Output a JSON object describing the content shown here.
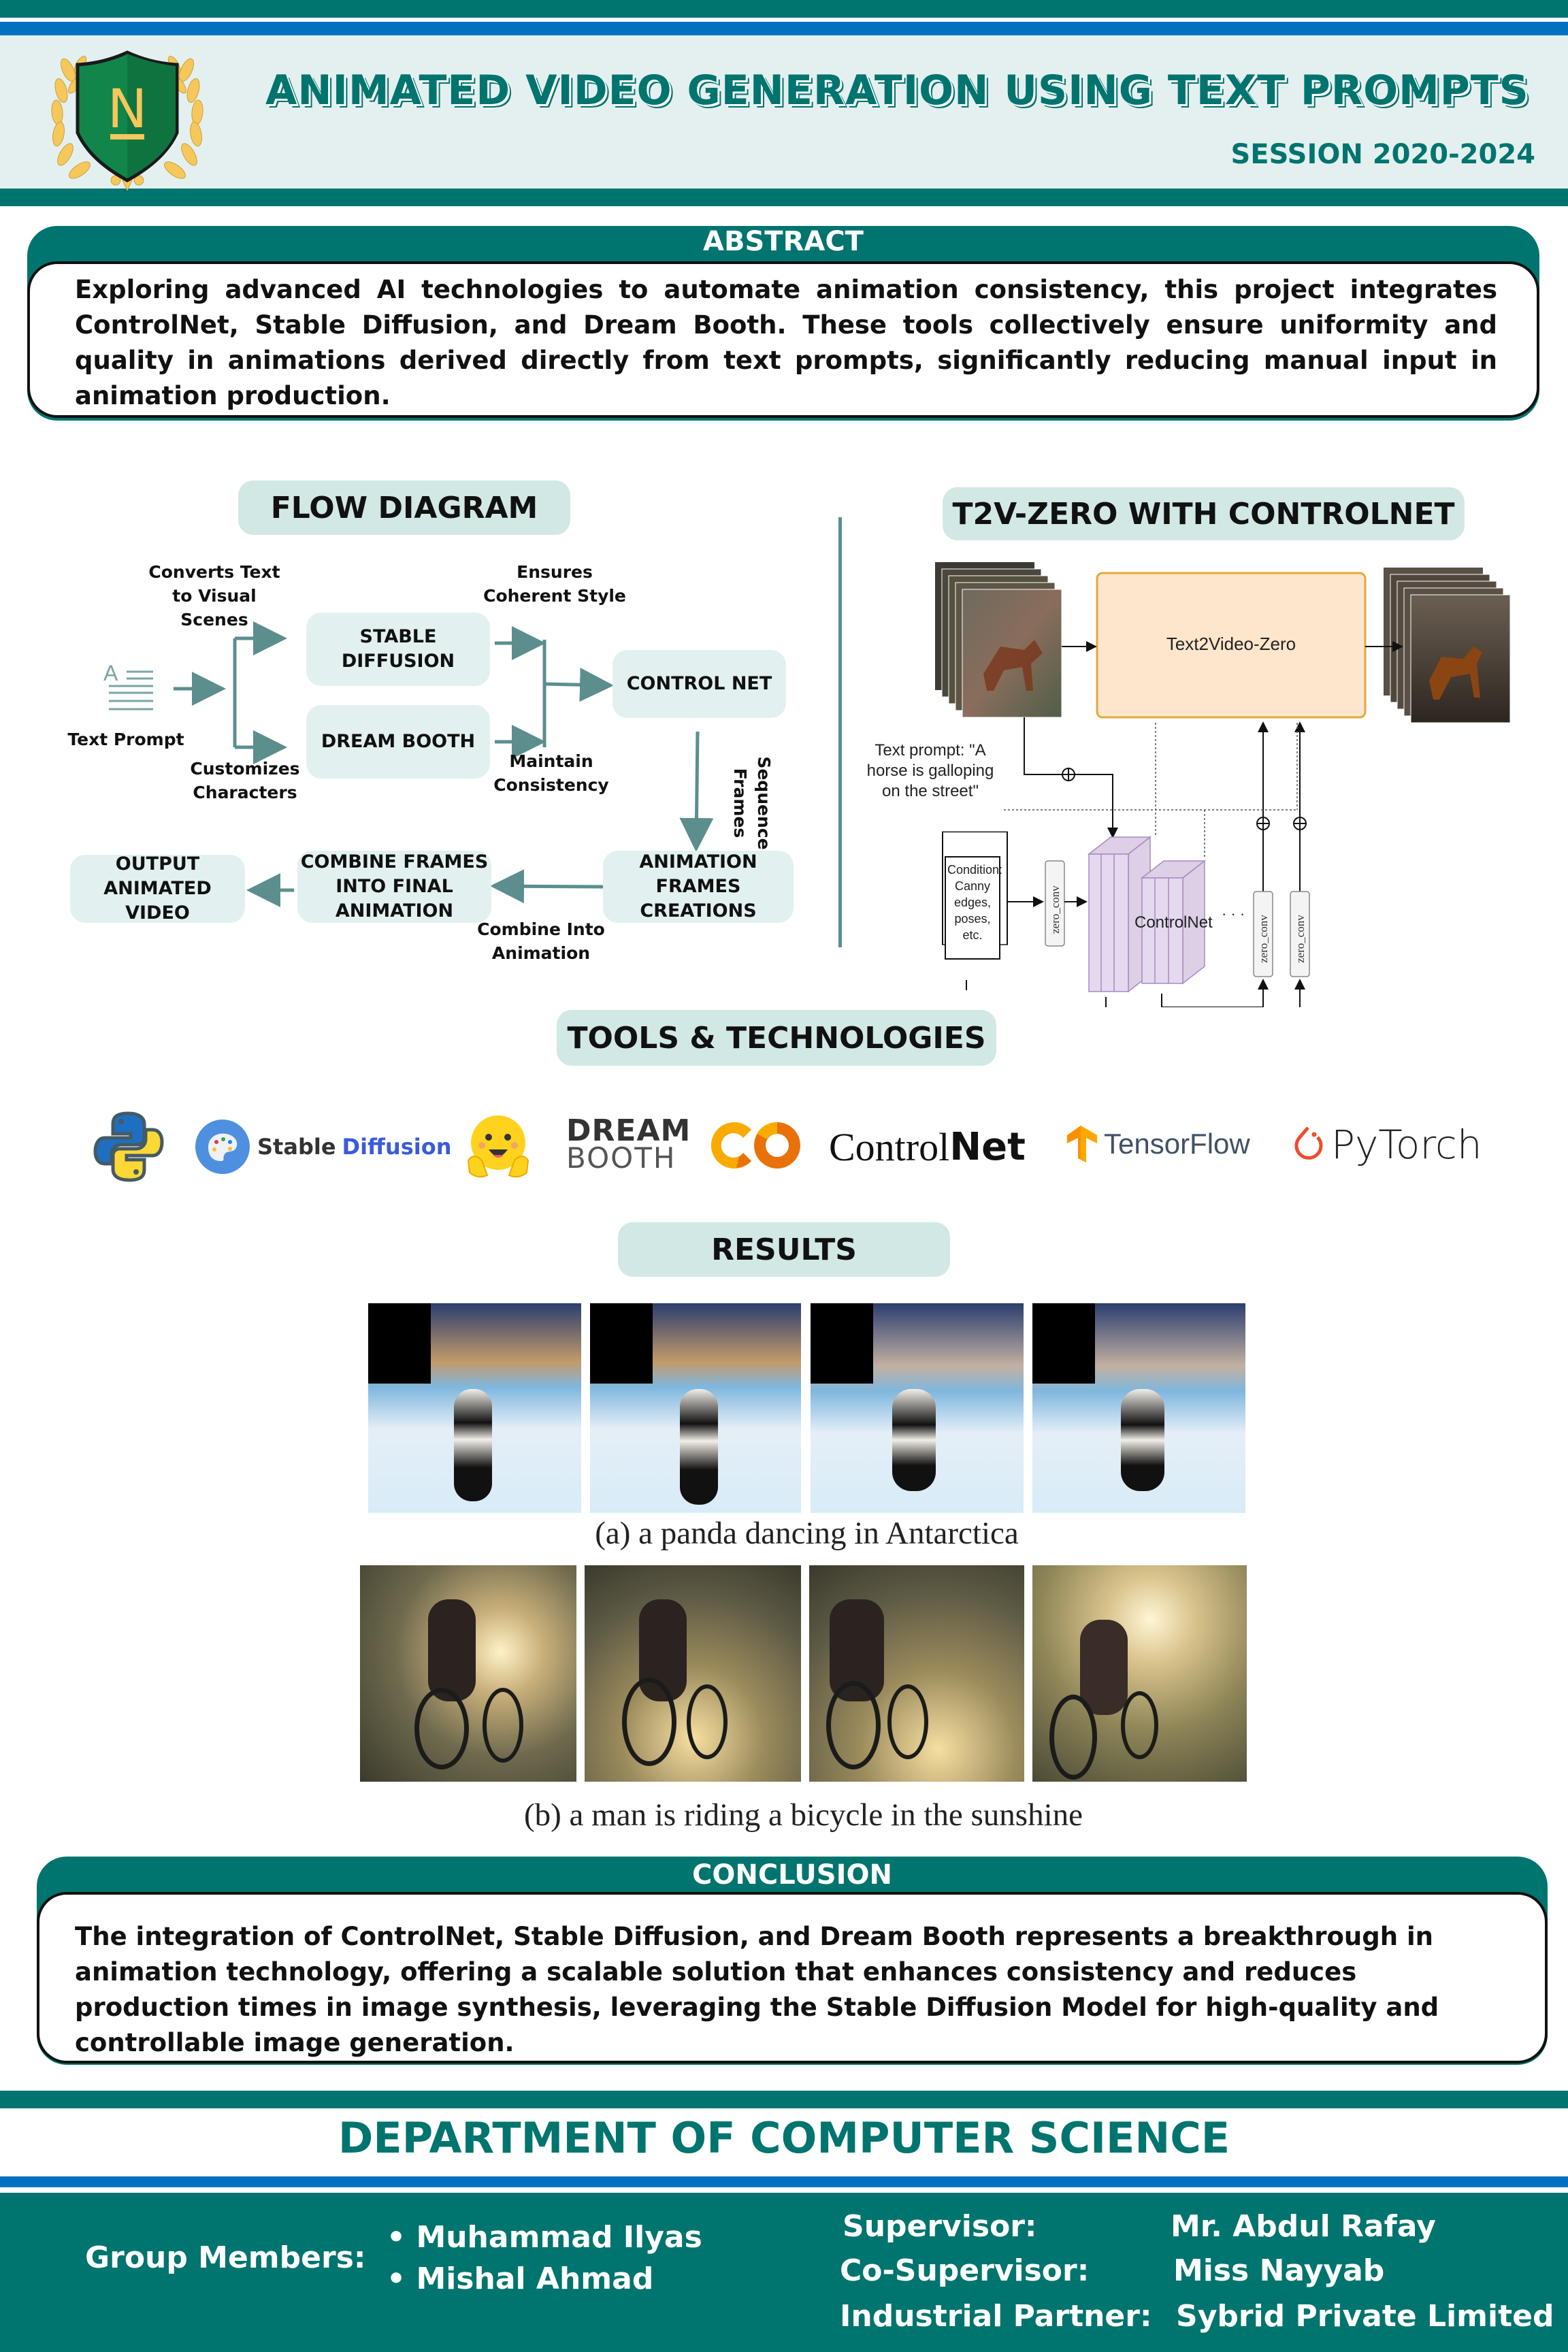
{
  "header": {
    "title": "ANIMATED VIDEO GENERATION USING TEXT PROMPTS",
    "session": "SESSION 2020-2024",
    "logo_letter": "N",
    "colors": {
      "teal": "#00746e",
      "blue": "#0070c0",
      "light_band": "#e4f0f0",
      "pill": "#d2e8e5",
      "gold": "#f6c75a",
      "shield_green": "#12854a"
    }
  },
  "abstract": {
    "title": "ABSTRACT",
    "text": "Exploring advanced AI technologies to automate animation consistency, this project integrates ControlNet, Stable Diffusion, and Dream Booth. These tools collectively ensure uniformity and quality in animations derived directly from text prompts, significantly reducing manual input in animation production."
  },
  "flow_diagram": {
    "title": "FLOW DIAGRAM",
    "input_label": "Text Prompt",
    "nodes": {
      "stable_diffusion": "STABLE DIFFUSION",
      "dream_booth": "DREAM BOOTH",
      "control_net": "CONTROL NET",
      "animation_frames": "ANIMATION FRAMES CREATIONS",
      "combine_frames": "COMBINE FRAMES INTO FINAL ANIMATION",
      "output_video": "OUTPUT ANIMATED VIDEO"
    },
    "edge_labels": {
      "converts": "Converts Text to Visual Scenes",
      "customizes": "Customizes Characters",
      "ensures": "Ensures Coherent Style",
      "maintain": "Maintain Consistency",
      "sequence": "Sequence Frames",
      "combine": "Combine Into Animation"
    }
  },
  "t2v": {
    "title": "T2V-ZERO WITH CONTROLNET",
    "main_block": "Text2Video-Zero",
    "prompt_label": "Text prompt: \"A horse is galloping on the street\"",
    "condition_label": "Condition: Canny edges, poses, etc.",
    "controlnet_label": "ControlNet",
    "zero_conv_label": "zero_conv",
    "ellipsis": "· · ·"
  },
  "tools": {
    "title": "TOOLS & TECHNOLOGIES",
    "items": [
      {
        "name": "Python",
        "icon": "python-icon"
      },
      {
        "name": "Stable Diffusion",
        "part1": "Stable",
        "part2": "Diffusion",
        "icon": "stable-diffusion-icon"
      },
      {
        "name": "Hugging Face",
        "icon": "hugging-face-icon"
      },
      {
        "name": "Dream Booth",
        "line1": "DREAM",
        "line2": "BOOTH",
        "icon": "dreambooth-icon"
      },
      {
        "name": "Google Colab",
        "text": "CO",
        "icon": "colab-icon"
      },
      {
        "name": "ControlNet",
        "part1": "Control",
        "part2": "Net"
      },
      {
        "name": "TensorFlow",
        "text": "TensorFlow",
        "icon": "tensorflow-icon"
      },
      {
        "name": "PyTorch",
        "text": "PyTorch",
        "icon": "pytorch-icon"
      }
    ]
  },
  "results": {
    "title": "RESULTS",
    "examples": [
      {
        "caption": "(a) a panda dancing in Antarctica",
        "frames": 4
      },
      {
        "caption": "(b) a man is riding a bicycle in the sunshine",
        "frames": 4
      }
    ]
  },
  "conclusion": {
    "title": "CONCLUSION",
    "text": "The integration of ControlNet, Stable Diffusion, and Dream Booth represents a breakthrough in animation technology, offering a scalable solution that enhances consistency and reduces production times in image synthesis, leveraging the Stable Diffusion Model for high-quality and controllable image generation."
  },
  "footer": {
    "department": "DEPARTMENT OF COMPUTER SCIENCE",
    "group_label": "Group Members:",
    "members": [
      "• Muhammad Ilyas",
      "• Mishal Ahmad"
    ],
    "roles": [
      {
        "label": "Supervisor:",
        "value": "Mr. Abdul Rafay"
      },
      {
        "label": "Co-Supervisor:",
        "value": "Miss Nayyab"
      },
      {
        "label": "Industrial Partner:",
        "value": "Sybrid Private Limited"
      }
    ]
  }
}
